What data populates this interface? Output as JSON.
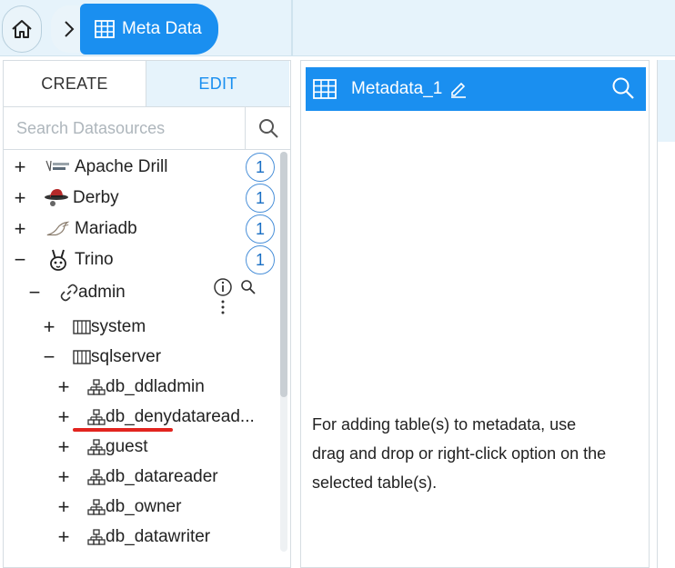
{
  "breadcrumb": {
    "home_icon": "home-icon",
    "chevron": ">",
    "current": "Meta Data"
  },
  "left_panel": {
    "tabs": [
      {
        "label": "CREATE",
        "active": false
      },
      {
        "label": "EDIT",
        "active": true
      }
    ],
    "search": {
      "placeholder": "Search Datasources",
      "value": ""
    },
    "tree": [
      {
        "expander": "+",
        "label": "Apache Drill",
        "count": "1"
      },
      {
        "expander": "+",
        "label": "Derby",
        "count": "1"
      },
      {
        "expander": "+",
        "label": "Mariadb",
        "count": "1"
      },
      {
        "expander": "−",
        "label": "Trino",
        "count": "1"
      },
      {
        "expander": "−",
        "label": "admin"
      },
      {
        "expander": "+",
        "label": "system"
      },
      {
        "expander": "−",
        "label": "sqlserver"
      },
      {
        "expander": "+",
        "label": "db_ddladmin"
      },
      {
        "expander": "+",
        "label": "db_denydataread..."
      },
      {
        "expander": "+",
        "label": "guest"
      },
      {
        "expander": "+",
        "label": "db_datareader"
      },
      {
        "expander": "+",
        "label": "db_owner"
      },
      {
        "expander": "+",
        "label": "db_datawriter"
      }
    ]
  },
  "metadata_panel": {
    "title": "Metadata_1",
    "hint": "For adding table(s) to metadata, use drag and drop or right-click option on the selected table(s)."
  },
  "colors": {
    "accent": "#1a8ff0",
    "light_blue": "#e6f3fb",
    "highlight_underline": "#e2241f"
  }
}
